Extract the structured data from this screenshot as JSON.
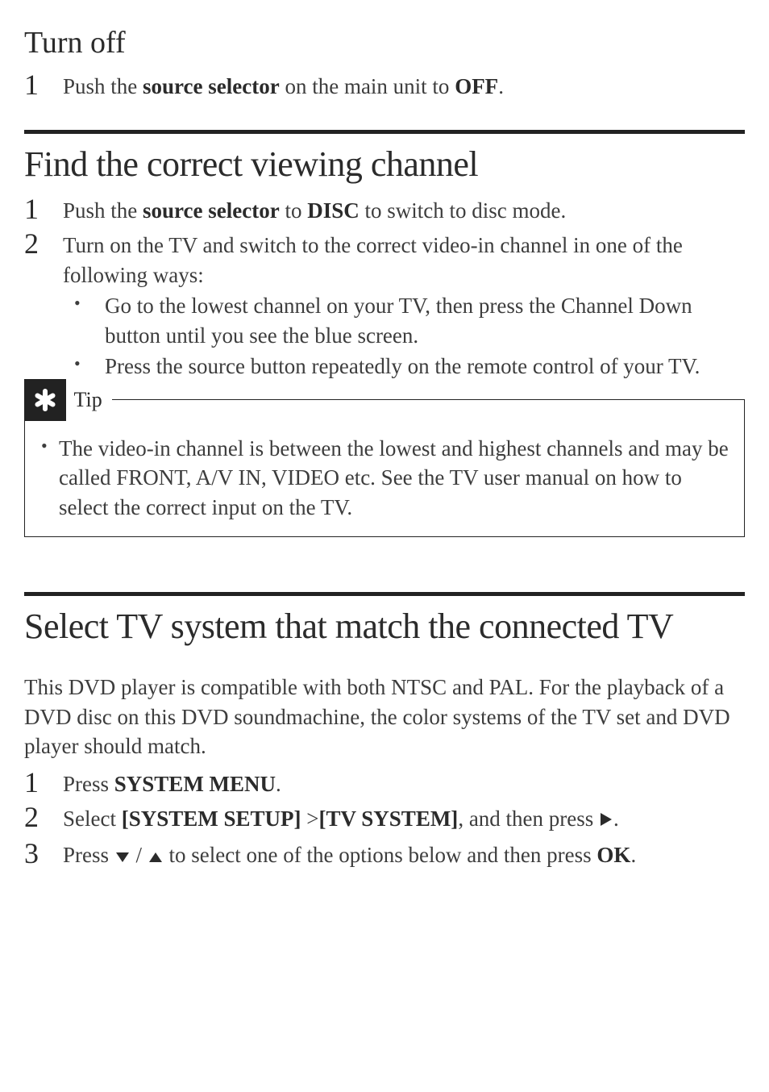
{
  "section_turnoff": {
    "heading": "Turn off",
    "step1": {
      "num": "1",
      "prefix": "Push the ",
      "bold1": "source selector",
      "mid": " on the main unit to ",
      "bold2": "OFF",
      "suffix": "."
    }
  },
  "section_find": {
    "heading": "Find the correct viewing channel",
    "step1": {
      "num": "1",
      "prefix": "Push the ",
      "bold1": "source selector",
      "mid": " to ",
      "bold2": "DISC",
      "suffix": " to switch to disc mode."
    },
    "step2": {
      "num": "2",
      "text": "Turn on the TV and switch to the correct video-in channel in one of the following ways:",
      "bullets": [
        "Go to the lowest channel on your TV, then press the Channel Down button until you see the blue screen.",
        "Press the source button repeatedly on the remote control of your TV."
      ]
    },
    "tip": {
      "label": "Tip",
      "text": "The video-in channel is between the lowest and highest channels and may be called FRONT, A/V IN, VIDEO etc. See the TV user manual on how to select the correct input on the TV."
    }
  },
  "section_tv": {
    "heading": "Select TV system that match the connected TV",
    "intro": "This DVD player is compatible with both NTSC and PAL. For the playback of a DVD disc on this DVD soundmachine, the color systems of the TV set and DVD player should match.",
    "step1": {
      "num": "1",
      "prefix": "Press ",
      "bold1": "SYSTEM MENU",
      "suffix": "."
    },
    "step2": {
      "num": "2",
      "prefix": "Select ",
      "bold1": "[SYSTEM SETUP]",
      "mid": " >",
      "bold2": "[TV SYSTEM]",
      "after": ", and then press ",
      "suffix": "."
    },
    "step3": {
      "num": "3",
      "prefix": "Press ",
      "mid": " / ",
      "after": " to select one of the options below and then press ",
      "bold1": "OK",
      "suffix": "."
    }
  }
}
